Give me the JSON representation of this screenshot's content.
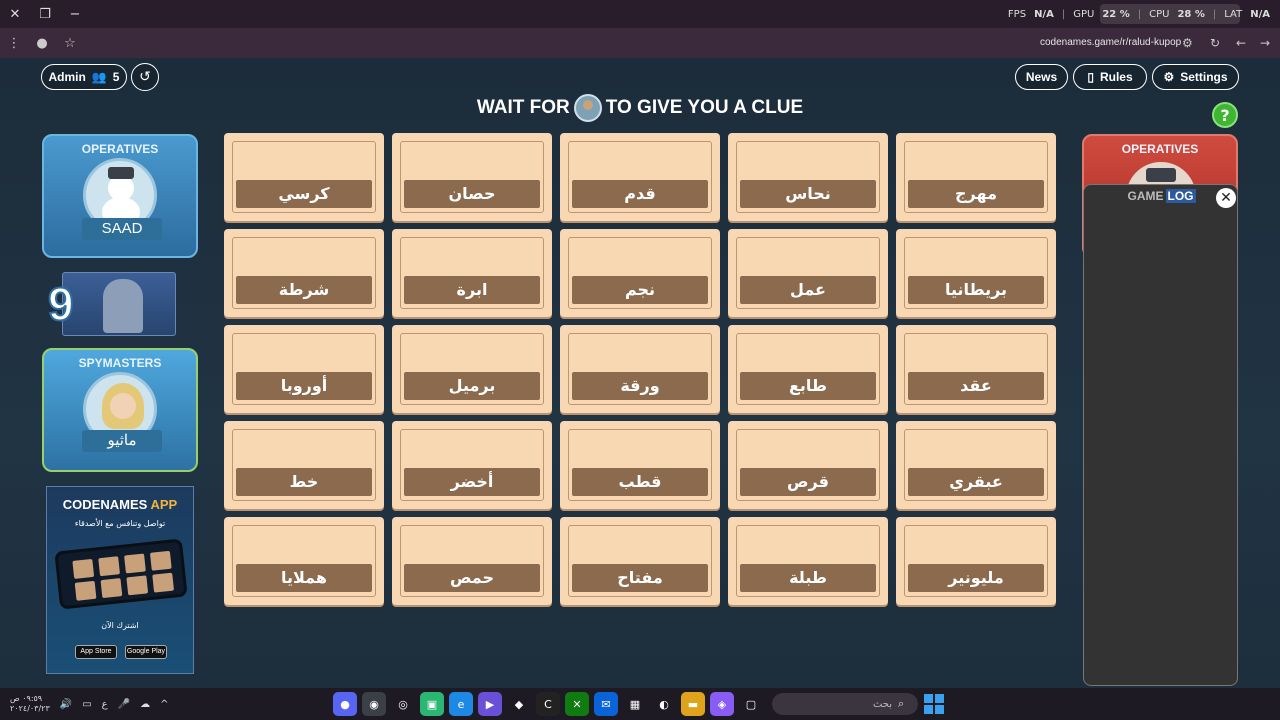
{
  "window": {
    "min_label": "−",
    "restore_label": "❐",
    "close_label": "✕"
  },
  "perf": {
    "fps_label": "FPS",
    "fps_value": "N/A",
    "gpu_label": "GPU",
    "gpu_value": "22 %",
    "cpu_label": "CPU",
    "cpu_value": "28 %",
    "lat_label": "LAT",
    "lat_value": "N/A"
  },
  "browser": {
    "url": "codenames.game/r/ralud-kupop"
  },
  "header": {
    "admin_label": "Admin",
    "player_count": "5",
    "news_label": "News",
    "rules_label": "Rules",
    "settings_label": "Settings",
    "clue_prefix": "WAIT FOR",
    "clue_suffix": "TO GIVE YOU A CLUE",
    "help_label": "?"
  },
  "blue_team": {
    "operatives_title": "OPERATIVES",
    "operative_name": "SAAD",
    "cards_left": "9",
    "spymasters_title": "SPYMASTERS",
    "spymaster_name": "ماثيو"
  },
  "app_banner": {
    "title_main": "CODENAMES",
    "title_accent": "APP",
    "subtitle": "تواصل وتنافس مع الأصدقاء",
    "join": "اشترك الآن",
    "app_store": "App Store",
    "google_play": "Google Play"
  },
  "board": {
    "rows": [
      [
        "كرسي",
        "حصان",
        "قدم",
        "نحاس",
        "مهرج"
      ],
      [
        "شرطة",
        "ابرة",
        "نجم",
        "عمل",
        "بريطانيا"
      ],
      [
        "أوروبا",
        "برميل",
        "ورقة",
        "طابع",
        "عقد"
      ],
      [
        "خط",
        "أخضر",
        "قطب",
        "قرص",
        "عبقري"
      ],
      [
        "هملايا",
        "حمص",
        "مفتاح",
        "طبلة",
        "مليونير"
      ]
    ]
  },
  "red_team": {
    "operatives_title": "OPERATIVES"
  },
  "game_log": {
    "title_a": "GAME",
    "title_b": "LOG",
    "close_label": "✕"
  },
  "taskbar": {
    "time": "٠٩:٥٩ ص",
    "date": "٢٠٢٤/٠٣/٢٣",
    "lang": "ع",
    "search_placeholder": "بحث"
  },
  "colors": {
    "card_bg": "#f7d8b2",
    "card_word_bg": "#8b6a4e",
    "blue_team": "#4a9ad0",
    "red_team": "#d04b3f",
    "help_green": "#3fb532"
  }
}
